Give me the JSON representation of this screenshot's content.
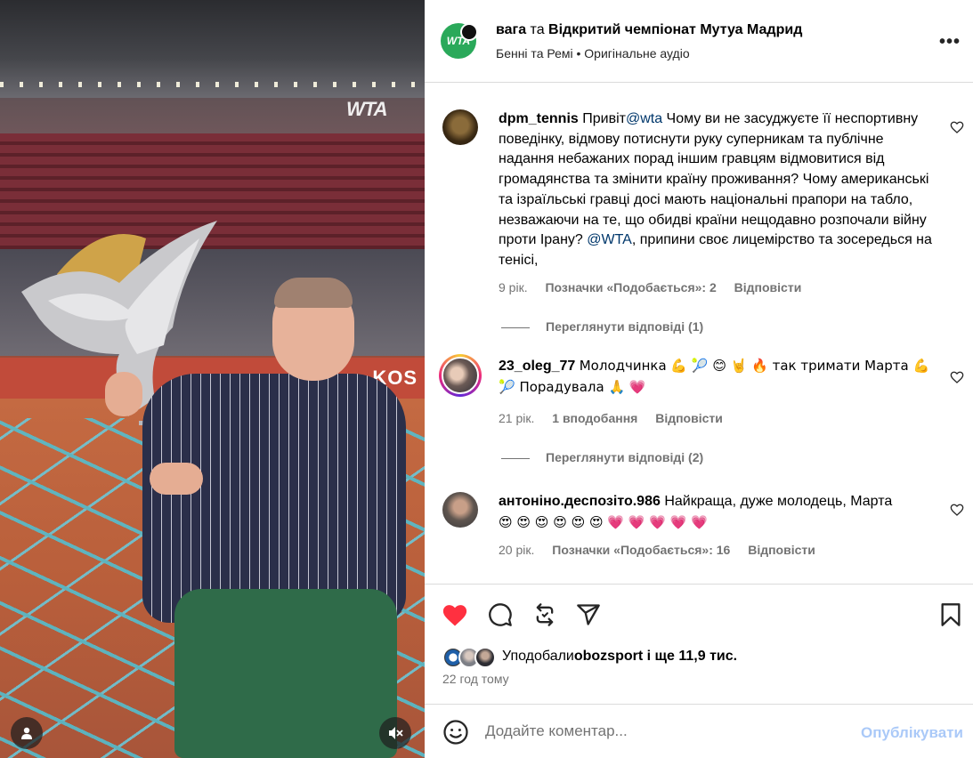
{
  "media": {
    "logo_text": "WTA",
    "banner_text": "KOS",
    "user_icon": "person-icon",
    "mute_icon": "speaker-muted-icon"
  },
  "header": {
    "account1": "вага",
    "joiner": "та",
    "account2": "Відкритий чемпіонат Мутуа Мадрид",
    "avatar_text": "WTA",
    "audio": "Бенні та Ремі • Оригінальне аудіо",
    "more_icon": "more-options-icon"
  },
  "comments": [
    {
      "username": "dpm_tennis",
      "text_before": "Привіт",
      "mention1": "@wta",
      "text_middle": " Чому ви не засуджуєте її неспортивну поведінку, відмову потиснути руку суперникам та публічне надання небажаних порад іншим гравцям відмовитися від громадянства та змінити країну проживання? Чому американські та ізраїльські гравці досі мають національні прапори на табло, незважаючи на те, що обидві країни нещодавно розпочали війну проти Ірану? ",
      "mention2": "@WTA",
      "text_after": ", припини своє лицемірство та зосередься на тенісі,",
      "age": "9 рік.",
      "likes": "Позначки «Подобається»: 2",
      "reply": "Відповісти",
      "view_replies": "Переглянути відповіді (1)"
    },
    {
      "username": "23_oleg_77",
      "text": "Молодчинка 💪 🎾 😊 🤘 🔥 так тримати Марта 💪 🎾 Порадувала 🙏 💗",
      "age": "21 рік.",
      "likes": "1 вподобання",
      "reply": "Відповісти",
      "view_replies": "Переглянути відповіді (2)"
    },
    {
      "username": "антоніно.деспозіто.986",
      "text": "Найкраща, дуже молодець, Марта",
      "emojis": "😍 😍 😍 😍 😍 😍 💗 💗 💗 💗 💗",
      "age": "20 рік.",
      "likes": "Позначки «Подобається»: 16",
      "reply": "Відповісти"
    }
  ],
  "actions": {
    "like_icon": "heart-filled-icon",
    "comment_icon": "comment-icon",
    "repost_icon": "repost-icon",
    "share_icon": "share-icon",
    "save_icon": "bookmark-icon",
    "liked_by_prefix": "Уподобали",
    "liked_by_user": "obozsport",
    "liked_by_suffix": " і ще 11,9 тис.",
    "time": "22 год тому"
  },
  "add_comment": {
    "placeholder": "Додайте коментар...",
    "post_label": "Опублікувати",
    "emoji_icon": "emoji-icon"
  },
  "colors": {
    "like_red": "#ff3040",
    "mention_blue": "#00376b",
    "post_disabled": "#aac9f8",
    "wta_green": "#2aa95a"
  }
}
